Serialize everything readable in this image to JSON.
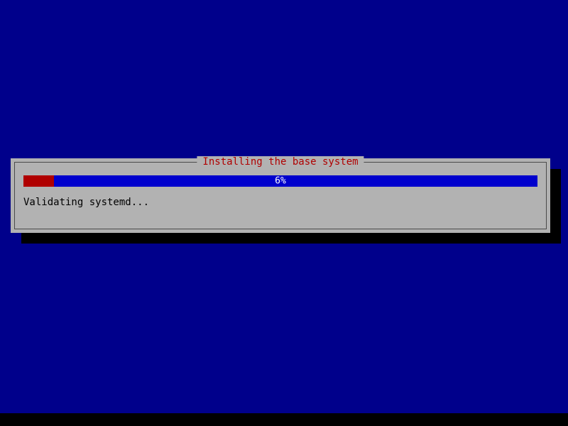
{
  "dialog": {
    "title": "Installing the base system",
    "progress": {
      "percent": 6,
      "label": "6%"
    },
    "status": "Validating systemd..."
  }
}
